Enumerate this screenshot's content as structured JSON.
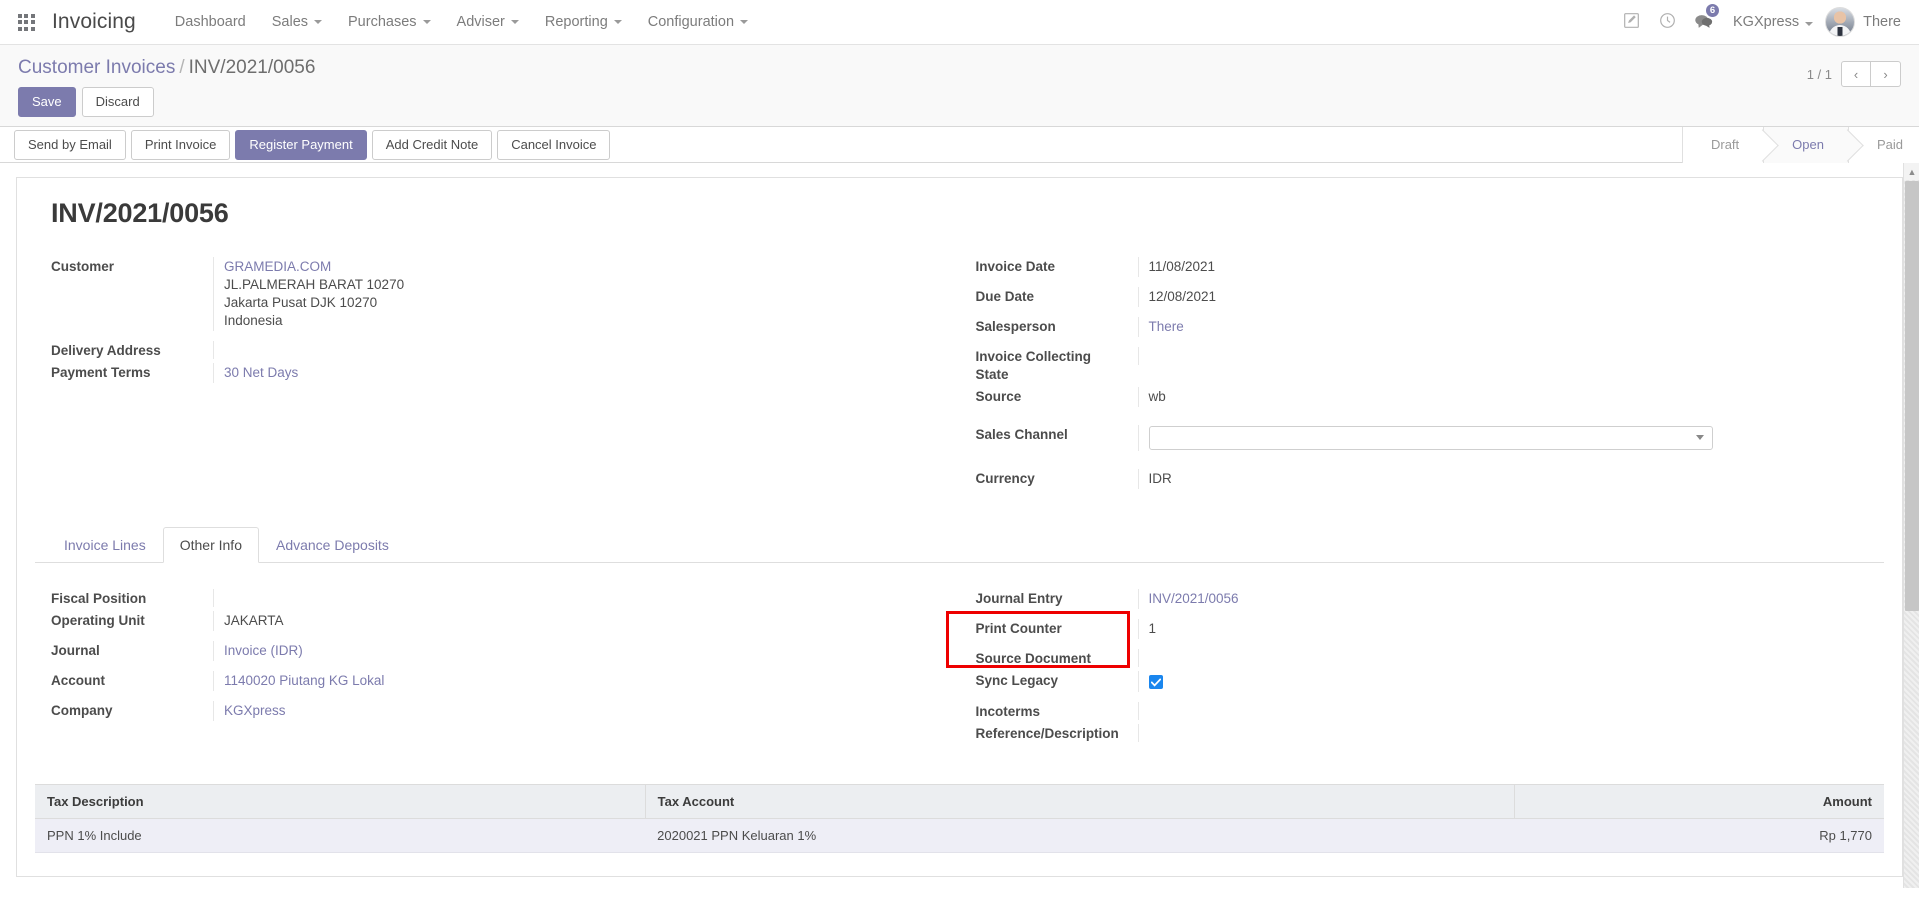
{
  "navbar": {
    "apps_icon": "apps-grid-icon",
    "brand": "Invoicing",
    "menu": [
      {
        "label": "Dashboard",
        "has_caret": false
      },
      {
        "label": "Sales",
        "has_caret": true
      },
      {
        "label": "Purchases",
        "has_caret": true
      },
      {
        "label": "Adviser",
        "has_caret": true
      },
      {
        "label": "Reporting",
        "has_caret": true
      },
      {
        "label": "Configuration",
        "has_caret": true
      }
    ],
    "edit_icon": "pencil-square-icon",
    "activity_icon": "clock-icon",
    "messages_icon": "chat-bubbles-icon",
    "messages_badge": "6",
    "company": "KGXpress",
    "user": "There"
  },
  "control_panel": {
    "breadcrumb_parent": "Customer Invoices",
    "breadcrumb_sep": "/",
    "breadcrumb_current": "INV/2021/0056",
    "save_label": "Save",
    "discard_label": "Discard",
    "pager_count": "1 / 1",
    "pager_prev": "‹",
    "pager_next": "›"
  },
  "action_bar": {
    "buttons": [
      {
        "label": "Send by Email",
        "primary": false
      },
      {
        "label": "Print Invoice",
        "primary": false
      },
      {
        "label": "Register Payment",
        "primary": true
      },
      {
        "label": "Add Credit Note",
        "primary": false
      },
      {
        "label": "Cancel Invoice",
        "primary": false
      }
    ],
    "status_steps": [
      {
        "label": "Draft",
        "active": false
      },
      {
        "label": "Open",
        "active": true
      },
      {
        "label": "Paid",
        "active": false
      }
    ]
  },
  "record": {
    "title": "INV/2021/0056",
    "left_fields": {
      "customer_label": "Customer",
      "customer_name": "GRAMEDIA.COM",
      "customer_address_1": "JL.PALMERAH BARAT 10270",
      "customer_address_2": "Jakarta Pusat DJK 10270",
      "customer_country": "Indonesia",
      "delivery_address_label": "Delivery Address",
      "delivery_address_value": "",
      "payment_terms_label": "Payment Terms",
      "payment_terms_value": "30 Net Days"
    },
    "right_fields": {
      "invoice_date_label": "Invoice Date",
      "invoice_date_value": "11/08/2021",
      "due_date_label": "Due Date",
      "due_date_value": "12/08/2021",
      "salesperson_label": "Salesperson",
      "salesperson_value": "There",
      "collecting_state_label": "Invoice Collecting State",
      "collecting_state_value": "",
      "source_label": "Source",
      "source_value": "wb",
      "sales_channel_label": "Sales Channel",
      "sales_channel_value": "",
      "currency_label": "Currency",
      "currency_value": "IDR"
    }
  },
  "notebook": {
    "tabs": [
      {
        "label": "Invoice Lines",
        "active": false
      },
      {
        "label": "Other Info",
        "active": true
      },
      {
        "label": "Advance Deposits",
        "active": false
      }
    ]
  },
  "other_info": {
    "left": {
      "fiscal_position_label": "Fiscal Position",
      "fiscal_position_value": "",
      "operating_unit_label": "Operating Unit",
      "operating_unit_value": "JAKARTA",
      "journal_label": "Journal",
      "journal_value": "Invoice (IDR)",
      "account_label": "Account",
      "account_value": "1140020 Piutang KG Lokal",
      "company_label": "Company",
      "company_value": "KGXpress"
    },
    "right": {
      "journal_entry_label": "Journal Entry",
      "journal_entry_value": "INV/2021/0056",
      "print_counter_label": "Print Counter",
      "print_counter_value": "1",
      "source_document_label": "Source Document",
      "source_document_value": "",
      "sync_legacy_label": "Sync Legacy",
      "sync_legacy_checked": true,
      "incoterms_label": "Incoterms",
      "incoterms_value": "",
      "reference_label": "Reference/Description",
      "reference_value": ""
    }
  },
  "tax_table": {
    "columns": [
      "Tax Description",
      "Tax Account",
      "Amount"
    ],
    "rows": [
      {
        "description": "PPN 1% Include",
        "account": "2020021 PPN Keluaran 1%",
        "amount": "Rp 1,770"
      }
    ]
  },
  "colors": {
    "accent": "#7c7bad",
    "highlight": "#ee0000",
    "checkbox": "#1a86ee",
    "link": "#7c7bad"
  }
}
